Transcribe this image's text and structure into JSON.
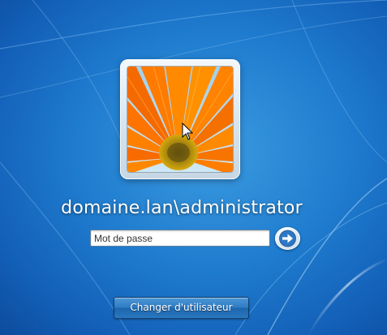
{
  "login": {
    "username": "domaine.lan\\administrator",
    "password_placeholder": "Mot de passe",
    "password_value": "",
    "switch_user_label": "Changer d'utilisateur",
    "avatar_image": "orange-gerbera-flower-picture",
    "submit_icon": "arrow-right-icon"
  },
  "colors": {
    "background": "#1f7ccf",
    "text": "#ffffff"
  }
}
